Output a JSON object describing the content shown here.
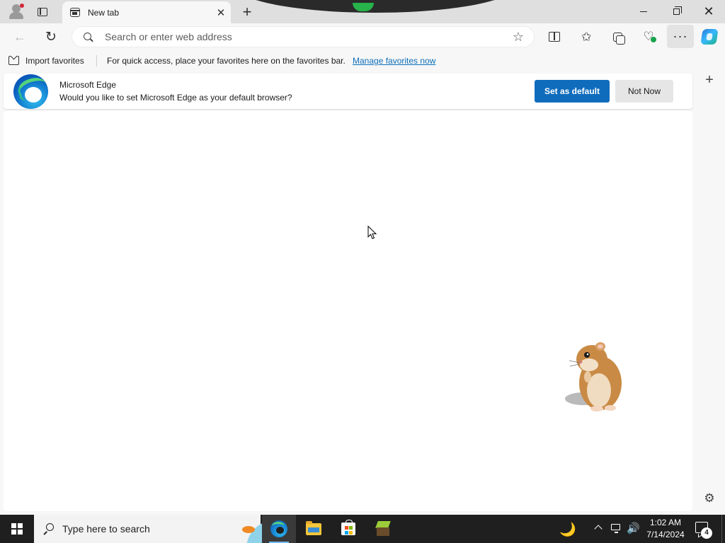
{
  "tab": {
    "title": "New tab"
  },
  "toolbar": {
    "address_placeholder": "Search or enter web address"
  },
  "favorites_bar": {
    "import_label": "Import favorites",
    "quick_access_text": "For quick access, place your favorites here on the favorites bar.",
    "manage_link": "Manage favorites now"
  },
  "infobar": {
    "title": "Microsoft Edge",
    "message": "Would you like to set Microsoft Edge as your default browser?",
    "primary_button": "Set as default",
    "secondary_button": "Not Now"
  },
  "taskbar": {
    "search_label": "Type here to search",
    "time": "1:02 AM",
    "date": "7/14/2024",
    "notification_count": "4"
  },
  "colors": {
    "accent": "#0f6cbd",
    "link": "#0d6fb8",
    "taskbar": "#1f1f1f",
    "chrome": "#f7f7f7"
  },
  "icons": {
    "profile": "profile-icon",
    "tab_actions": "tab-actions-icon",
    "new_tab": "plus-icon",
    "back": "back-arrow-icon",
    "refresh": "refresh-icon",
    "search": "search-icon",
    "favorite": "star-icon",
    "split_screen": "split-screen-icon",
    "favorites": "favorites-icon",
    "collections": "collections-icon",
    "performance": "performance-icon",
    "more": "more-icon",
    "copilot": "copilot-icon",
    "sidebar_add": "plus-icon",
    "sidebar_settings": "gear-icon"
  }
}
